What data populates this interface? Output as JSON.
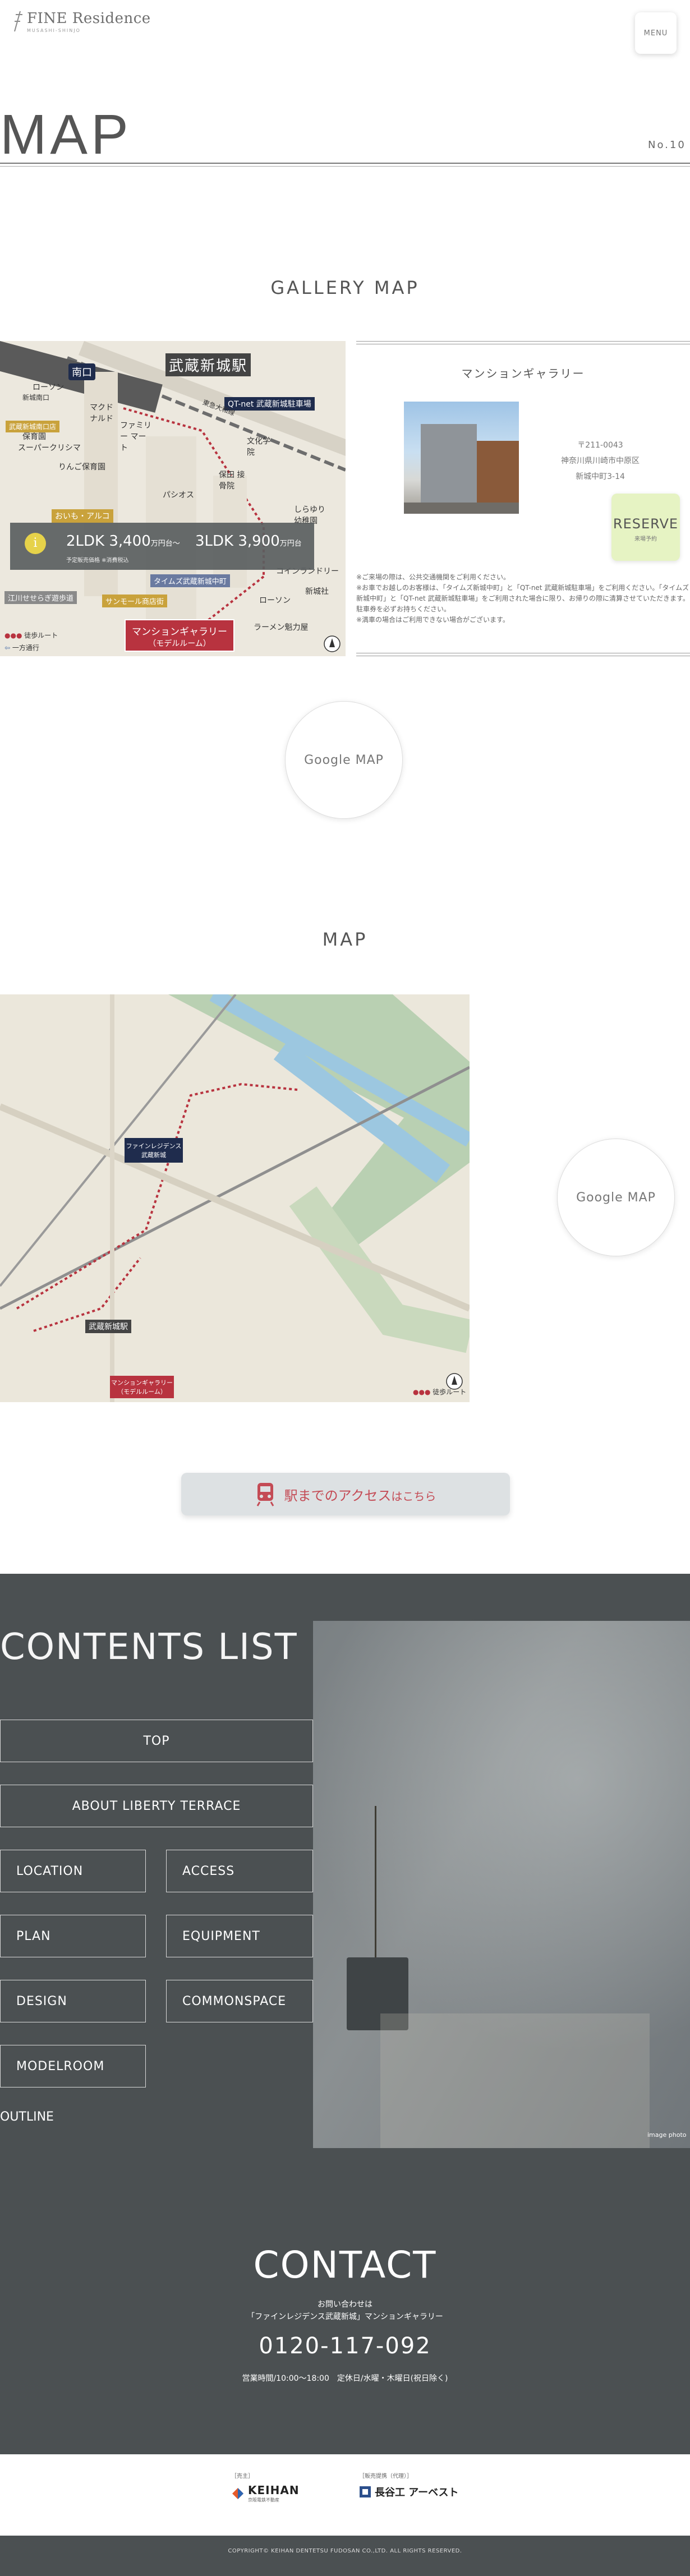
{
  "header": {
    "logo_text": "FINE Residence",
    "logo_sub": "MUSASHI-SHINJO",
    "menu_label": "MENU"
  },
  "page": {
    "title": "MAP",
    "number": "No.10"
  },
  "gallery_map": {
    "heading": "GALLERY MAP",
    "station_name": "武蔵新城駅",
    "station_exit": "南口",
    "labels": [
      "ローソン",
      "新城南口",
      "マクド ナルド",
      "ファミリー マート",
      "QT-net 武蔵新城駐車場",
      "スーパークリシマ",
      "ハロー 保育園",
      "りんご保育園",
      "武蔵新城南口店",
      "東急大和線",
      "文化学 院",
      "保田 接骨院",
      "パシオス",
      "しらゆり 幼稚園",
      "おいも・アルコ",
      "タイムズ武蔵新城中町",
      "江川せせらぎ遊歩道",
      "サンモール商店街",
      "コインランドリー",
      "ローソン",
      "新城社",
      "ラーメン魁力屋"
    ],
    "price_banner": {
      "icon": "i",
      "text_2ldk": "2LDK 3,400",
      "unit1": "万円台〜",
      "text_3ldk": "3LDK 3,900",
      "unit2": "万円台",
      "note": "予定販売価格 ※消費税込"
    },
    "gallery_tag_line1": "マンションギャラリー",
    "gallery_tag_line2": "（モデルルーム）",
    "legend_walk": "徒歩ルート",
    "legend_oneway": "一方通行"
  },
  "gallery_card": {
    "title": "マンションギャラリー",
    "postal": "〒211-0043",
    "address1": "神奈川県川崎市中原区",
    "address2": "新城中町3-14",
    "reserve_label": "RESERVE",
    "reserve_sub": "来場予約",
    "notes": "※ご来場の際は、公共交通機関をご利用ください。\n※お車でお越しのお客様は、「タイムズ新城中町」と「QT-net 武蔵新城駐車場」をご利用ください。「タイムズ新城中町」と「QT-net 武蔵新城駐車場」をご利用された場合に限り、お帰りの際に清算させていただきます。駐車券を必ずお持ちください。\n※満車の場合はご利用できない場合がございます。"
  },
  "google_map_button": "Google MAP",
  "map_section": {
    "heading": "MAP",
    "station_tag": "武蔵新城駅",
    "site_tag_line1": "ファインレジデンス",
    "site_tag_line2": "武蔵新城",
    "gallery_tag_line1": "マンションギャラリー",
    "gallery_tag_line2": "（モデルルーム）",
    "legend_walk": "徒歩ルート",
    "google_map_button": "Google MAP"
  },
  "access_button": {
    "main": "駅までのアクセス",
    "suffix": "はこちら"
  },
  "contents": {
    "title": "CONTENTS LIST",
    "items": [
      "TOP",
      "ABOUT LIBERTY TERRACE",
      "LOCATION",
      "ACCESS",
      "PLAN",
      "EQUIPMENT",
      "DESIGN",
      "COMMONSPACE",
      "MODELROOM"
    ],
    "outline": "OUTLINE",
    "photo_caption": "image photo"
  },
  "contact": {
    "title": "CONTACT",
    "sub1": "お問い合わせは",
    "sub2": "「ファインレジデンス武蔵新城」マンションギャラリー",
    "tel": "0120-117-092",
    "hours": "営業時間/10:00〜18:00　定休日/水曜・木曜日(祝日除く)"
  },
  "sponsors": {
    "seller_label": "［売主］",
    "seller_name": "KEIHAN",
    "seller_sub": "京阪電鉄不動産",
    "agent_label": "［販売提携（代理）］",
    "agent_name": "長谷工 アーベスト"
  },
  "copyright": "COPYRIGHT© KEIHAN DENTETSU FUDOSAN CO.,LTD. ALL RIGHTS RESERVED.",
  "colors": {
    "dark_panel": "#4b5052",
    "reserve_bg": "#e6f3c3",
    "access_text": "#c44b55",
    "route_red": "#b8333f",
    "navy_tag": "#1f2c4d"
  }
}
